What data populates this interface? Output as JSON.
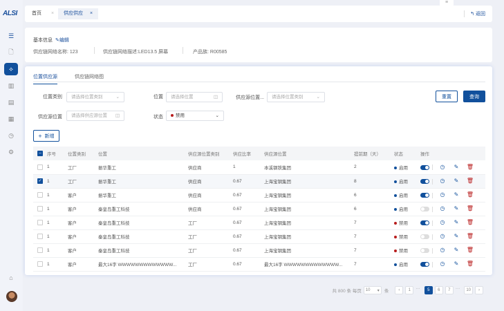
{
  "brand": "ALSI",
  "sidebar": {
    "items": [
      "menu-icon",
      "document-icon",
      "network-icon",
      "chart-icon",
      "list-icon",
      "calendar-icon",
      "clock-icon",
      "settings-icon"
    ],
    "active": 2
  },
  "tabs": [
    {
      "label": "首页"
    },
    {
      "label": "供应供应"
    }
  ],
  "back_label": "返回",
  "info": {
    "title": "基本信息",
    "edit": "编辑",
    "fields": [
      {
        "label": "供应链网络名称:",
        "value": "123"
      },
      {
        "label": "供应链网络描述:",
        "value": "LED13.5 屏幕"
      },
      {
        "label": "产品族:",
        "value": "R00585"
      }
    ]
  },
  "subtabs": [
    "位置供应源",
    "供应链网络图"
  ],
  "filters": {
    "location_type": {
      "label": "位置类别",
      "placeholder": "请选择位置类别"
    },
    "location": {
      "label": "位置",
      "placeholder": "请选择位置"
    },
    "source_type": {
      "label": "供应源位置...",
      "placeholder": "请选择位置类别"
    },
    "source_location": {
      "label": "供应源位置",
      "placeholder": "请选择供应源位置"
    },
    "status": {
      "label": "状态",
      "value": "禁用"
    }
  },
  "buttons": {
    "reset": "重置",
    "query": "查询",
    "add": "新增"
  },
  "table": {
    "headers": [
      "序号",
      "位置类别",
      "位置",
      "供应源位置类别",
      "供应比率",
      "供应源位置",
      "提前期（天）",
      "状态",
      "操作"
    ],
    "rows": [
      {
        "seq": "1",
        "type": "工厂",
        "loc": "振华重工",
        "src_type": "供应商",
        "ratio": "1",
        "src_loc": "本溪钢铁集团",
        "lead": "2",
        "status": "启用",
        "enabled": true,
        "toggle": true,
        "checked": false
      },
      {
        "seq": "1",
        "type": "工厂",
        "loc": "振华重工",
        "src_type": "供应商",
        "ratio": "0.67",
        "src_loc": "上海宝钢集团",
        "lead": "8",
        "status": "启用",
        "enabled": true,
        "toggle": true,
        "checked": true
      },
      {
        "seq": "1",
        "type": "客户",
        "loc": "振华重工",
        "src_type": "供应商",
        "ratio": "0.67",
        "src_loc": "上海宝钢集团",
        "lead": "6",
        "status": "启用",
        "enabled": true,
        "toggle": true,
        "checked": false
      },
      {
        "seq": "1",
        "type": "客户",
        "loc": "秦皇岛重工科技",
        "src_type": "供应商",
        "ratio": "0.67",
        "src_loc": "上海宝钢集团",
        "lead": "6",
        "status": "启用",
        "enabled": true,
        "toggle": false,
        "checked": false
      },
      {
        "seq": "1",
        "type": "客户",
        "loc": "秦皇岛重工科技",
        "src_type": "工厂",
        "ratio": "0.67",
        "src_loc": "上海宝钢集团",
        "lead": "7",
        "status": "禁用",
        "enabled": false,
        "toggle": true,
        "checked": false
      },
      {
        "seq": "1",
        "type": "客户",
        "loc": "秦皇岛重工科技",
        "src_type": "工厂",
        "ratio": "0.67",
        "src_loc": "上海宝钢集团",
        "lead": "7",
        "status": "禁用",
        "enabled": false,
        "toggle": false,
        "checked": false
      },
      {
        "seq": "1",
        "type": "客户",
        "loc": "秦皇岛重工科技",
        "src_type": "工厂",
        "ratio": "0.67",
        "src_loc": "上海宝钢集团",
        "lead": "7",
        "status": "禁用",
        "enabled": false,
        "toggle": false,
        "checked": false
      },
      {
        "seq": "1",
        "type": "客户",
        "loc": "最大16字 WWWWWWWWWWWWW...",
        "src_type": "工厂",
        "ratio": "0.67",
        "src_loc": "最大16字 WWWWWWWWWWWWW...",
        "lead": "7",
        "status": "启用",
        "enabled": true,
        "toggle": true,
        "checked": false
      }
    ]
  },
  "pagination": {
    "total": "共 800 条",
    "per_page_label": "每页",
    "per_page": "10",
    "unit": "条",
    "pages": [
      "1",
      "···",
      "5",
      "6",
      "7",
      "···",
      "10"
    ],
    "current": "5"
  },
  "colors": {
    "primary": "#11509c",
    "danger": "#b81d1d"
  }
}
